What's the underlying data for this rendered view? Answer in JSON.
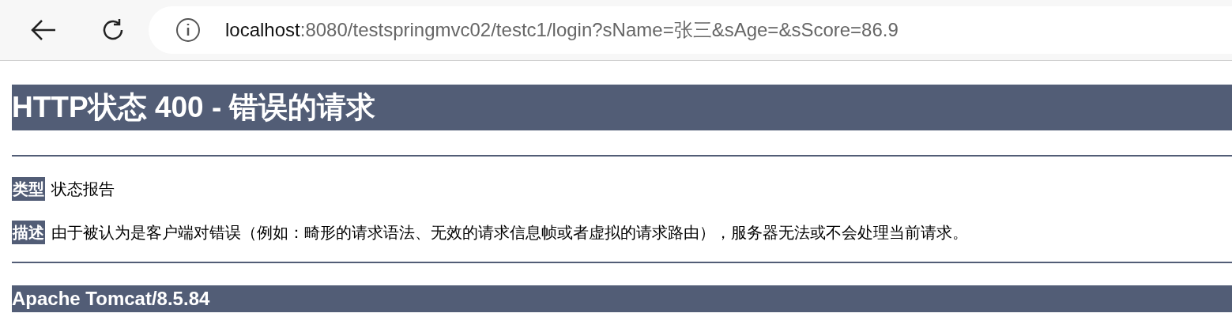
{
  "browser": {
    "url_host": "localhost",
    "url_rest": ":8080/testspringmvc02/testc1/login?sName=张三&sAge=&sScore=86.9"
  },
  "heading": "HTTP状态 400 - 错误的请求",
  "fields": [
    {
      "label": "类型",
      "value": "状态报告"
    },
    {
      "label": "描述",
      "value": "由于被认为是客户端对错误（例如：畸形的请求语法、无效的请求信息帧或者虚拟的请求路由），服务器无法或不会处理当前请求。"
    }
  ],
  "footer": "Apache Tomcat/8.5.84"
}
